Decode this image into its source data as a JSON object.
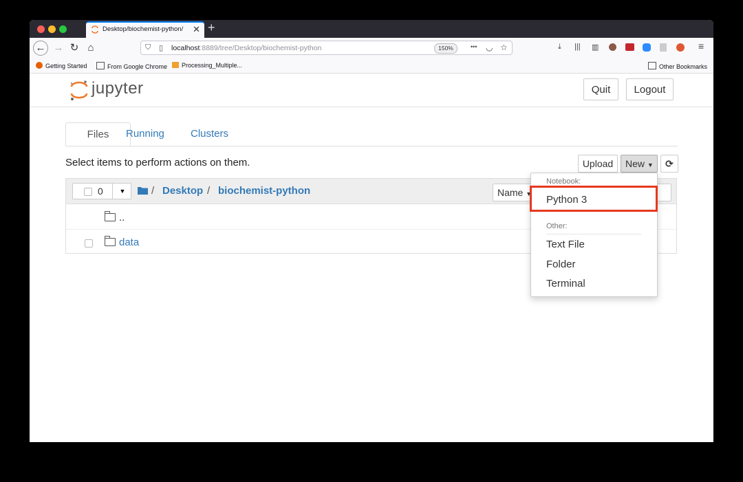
{
  "browser": {
    "tab_title": "Desktop/biochemist-python/",
    "tab_close": "✕",
    "new_tab": "+",
    "url_host": "localhost",
    "url_path": ":8889/tree/Desktop/biochemist-python",
    "zoom": "150%",
    "url_more": "•••",
    "bookmarks": {
      "getting_started": "Getting Started",
      "from_chrome": "From Google Chrome",
      "processing": "Processing_Multiple...",
      "other": "Other Bookmarks"
    }
  },
  "jupyter": {
    "logo_text": "jupyter",
    "quit": "Quit",
    "logout": "Logout",
    "tabs": [
      "Files",
      "Running",
      "Clusters"
    ],
    "select_msg": "Select items to perform actions on them.",
    "upload": "Upload",
    "new": "New",
    "selected_count": "0",
    "breadcrumb": [
      "Desktop",
      "biochemist-python"
    ],
    "sort_label": "Name",
    "rows": [
      "..",
      "data"
    ]
  },
  "dropdown": {
    "notebook_header": "Notebook:",
    "python3": "Python 3",
    "other_header": "Other:",
    "text_file": "Text File",
    "folder": "Folder",
    "terminal": "Terminal"
  },
  "colors": {
    "link": "#337ab7",
    "highlight": "#e5391f",
    "jupyter_orange": "#f37726"
  }
}
